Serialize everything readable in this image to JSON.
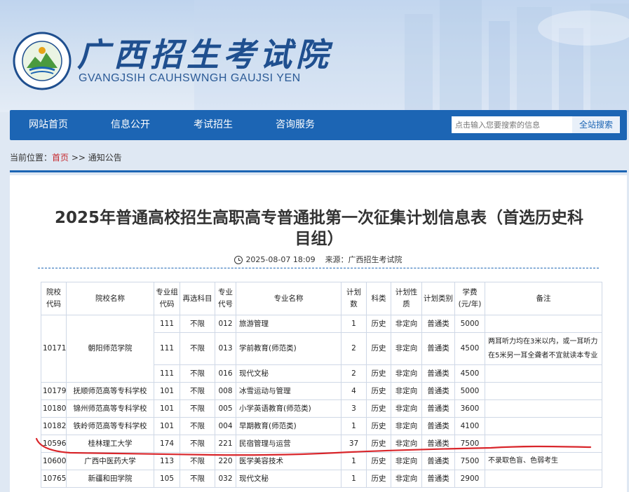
{
  "header": {
    "logo_cn": "广西招生考试院",
    "logo_en": "GVANGJSIH CAUHSWNGH GAUJSI YEN"
  },
  "nav": {
    "items": [
      "网站首页",
      "信息公开",
      "考试招生",
      "咨询服务"
    ],
    "search_placeholder": "点击输入您要搜索的信息",
    "search_button": "全站搜索"
  },
  "breadcrumb": {
    "prefix": "当前位置：",
    "home": "首页",
    "separator": " >> ",
    "current": "通知公告"
  },
  "article": {
    "title_line1": "2025年普通高校招生高职高专普通批第一次征集计划信息表（首选历史科",
    "title_line2": "目组）",
    "date": "2025-08-07 18:09",
    "source": "来源：广西招生考试院"
  },
  "table": {
    "headers": {
      "school_code": "院校代码",
      "school_name": "院校名称",
      "group_code": "专业组代码",
      "reselect": "再选科目",
      "major_code": "专业代号",
      "major_name": "专业名称",
      "plan_count": "计划数",
      "category": "科类",
      "plan_nature": "计划性质",
      "plan_type": "计划类别",
      "tuition": "学费(元/年)",
      "remark": "备注"
    },
    "group_10171": {
      "school_code": "10171",
      "school_name": "朝阳师范学院",
      "rows": [
        {
          "group": "111",
          "reselect": "不限",
          "major_code": "012",
          "major": "旅游管理",
          "count": "1",
          "category": "历史",
          "nature": "非定向",
          "type": "普通类",
          "fee": "5000",
          "remark": ""
        },
        {
          "group": "111",
          "reselect": "不限",
          "major_code": "013",
          "major": "学前教育(师范类)",
          "count": "2",
          "category": "历史",
          "nature": "非定向",
          "type": "普通类",
          "fee": "4500",
          "remark": "两耳听力均在3米以内，或一耳听力在5米另一耳全聋者不宜就读本专业"
        },
        {
          "group": "111",
          "reselect": "不限",
          "major_code": "016",
          "major": "现代文秘",
          "count": "2",
          "category": "历史",
          "nature": "非定向",
          "type": "普通类",
          "fee": "4500",
          "remark": ""
        }
      ]
    },
    "rows": [
      {
        "school_code": "10179",
        "school_name": "抚顺师范高等专科学校",
        "group": "101",
        "reselect": "不限",
        "major_code": "008",
        "major": "冰雪运动与管理",
        "count": "4",
        "category": "历史",
        "nature": "非定向",
        "type": "普通类",
        "fee": "5000",
        "remark": ""
      },
      {
        "school_code": "10180",
        "school_name": "锦州师范高等专科学校",
        "group": "101",
        "reselect": "不限",
        "major_code": "005",
        "major": "小学英语教育(师范类)",
        "count": "3",
        "category": "历史",
        "nature": "非定向",
        "type": "普通类",
        "fee": "3600",
        "remark": ""
      },
      {
        "school_code": "10182",
        "school_name": "铁岭师范高等专科学校",
        "group": "101",
        "reselect": "不限",
        "major_code": "004",
        "major": "早期教育(师范类)",
        "count": "1",
        "category": "历史",
        "nature": "非定向",
        "type": "普通类",
        "fee": "4100",
        "remark": ""
      },
      {
        "school_code": "10596",
        "school_name": "桂林理工大学",
        "group": "174",
        "reselect": "不限",
        "major_code": "221",
        "major": "民宿管理与运营",
        "count": "37",
        "category": "历史",
        "nature": "非定向",
        "type": "普通类",
        "fee": "7500",
        "remark": ""
      },
      {
        "school_code": "10600",
        "school_name": "广西中医药大学",
        "group": "113",
        "reselect": "不限",
        "major_code": "220",
        "major": "医学美容技术",
        "count": "1",
        "category": "历史",
        "nature": "非定向",
        "type": "普通类",
        "fee": "7500",
        "remark": "不录取色盲、色弱考生"
      },
      {
        "school_code": "10765",
        "school_name": "新疆和田学院",
        "group": "105",
        "reselect": "不限",
        "major_code": "032",
        "major": "现代文秘",
        "count": "1",
        "category": "历史",
        "nature": "非定向",
        "type": "普通类",
        "fee": "2900",
        "remark": ""
      }
    ]
  },
  "colors": {
    "nav_blue": "#1c65b4",
    "link_red": "#c6282d",
    "annotation_red": "#d9262b"
  }
}
